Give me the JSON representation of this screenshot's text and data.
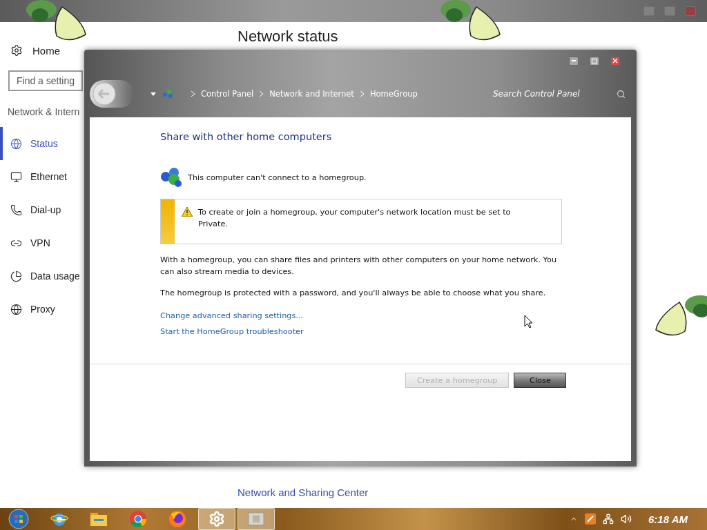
{
  "settings_window": {
    "home": "Home",
    "search_placeholder": "Find a setting",
    "section": "Network & Intern",
    "nav_items": [
      {
        "label": "Status",
        "kind": "status",
        "selected": true
      },
      {
        "label": "Ethernet",
        "kind": "ethernet",
        "selected": false
      },
      {
        "label": "Dial-up",
        "kind": "dialup",
        "selected": false
      },
      {
        "label": "VPN",
        "kind": "vpn",
        "selected": false
      },
      {
        "label": "Data usage",
        "kind": "data",
        "selected": false
      },
      {
        "label": "Proxy",
        "kind": "proxy",
        "selected": false
      }
    ],
    "heading": "Network status",
    "footer_link": "Network and Sharing Center"
  },
  "dialog": {
    "breadcrumbs": [
      "Control Panel",
      "Network and Internet",
      "HomeGroup"
    ],
    "search_placeholder": "Search Control Panel",
    "title": "Share with other home computers",
    "status": "This computer can't connect to a homegroup.",
    "warning": "To create or join a homegroup, your computer's network location must be set to Private.",
    "paragraphs": [
      "With a homegroup, you can share files and printers with other computers on your home network. You can also stream media to devices.",
      "The homegroup is protected with a password, and you'll always be able to choose what you share."
    ],
    "links": [
      "Change advanced sharing settings...",
      "Start the HomeGroup troubleshooter"
    ],
    "buttons": [
      {
        "label": "Create a homegroup",
        "disabled": true
      },
      {
        "label": "Close",
        "disabled": false
      }
    ]
  },
  "taskbar": {
    "apps": [
      {
        "kind": "ie",
        "active": false
      },
      {
        "kind": "folder",
        "active": false
      },
      {
        "kind": "chrome",
        "active": false
      },
      {
        "kind": "firefox",
        "active": false
      },
      {
        "kind": "settings",
        "active": true
      },
      {
        "kind": "homegroup",
        "active": true
      }
    ],
    "clock": "6:18 AM"
  }
}
